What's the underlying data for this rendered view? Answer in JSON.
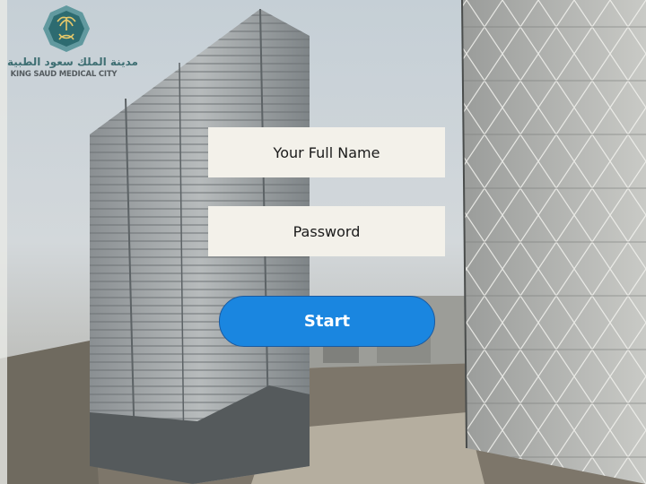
{
  "logo": {
    "arabic_text": "مدينة الملك سعود الطبية",
    "english_text": "KING SAUD MEDICAL CITY",
    "icon": "palm-swords-emblem-icon"
  },
  "form": {
    "name_placeholder": "Your Full Name",
    "password_placeholder": "Password",
    "start_label": "Start"
  },
  "colors": {
    "button": "#1a86e0",
    "field_background": "#f3f1ea",
    "logo_teal": "#3f6f73"
  }
}
